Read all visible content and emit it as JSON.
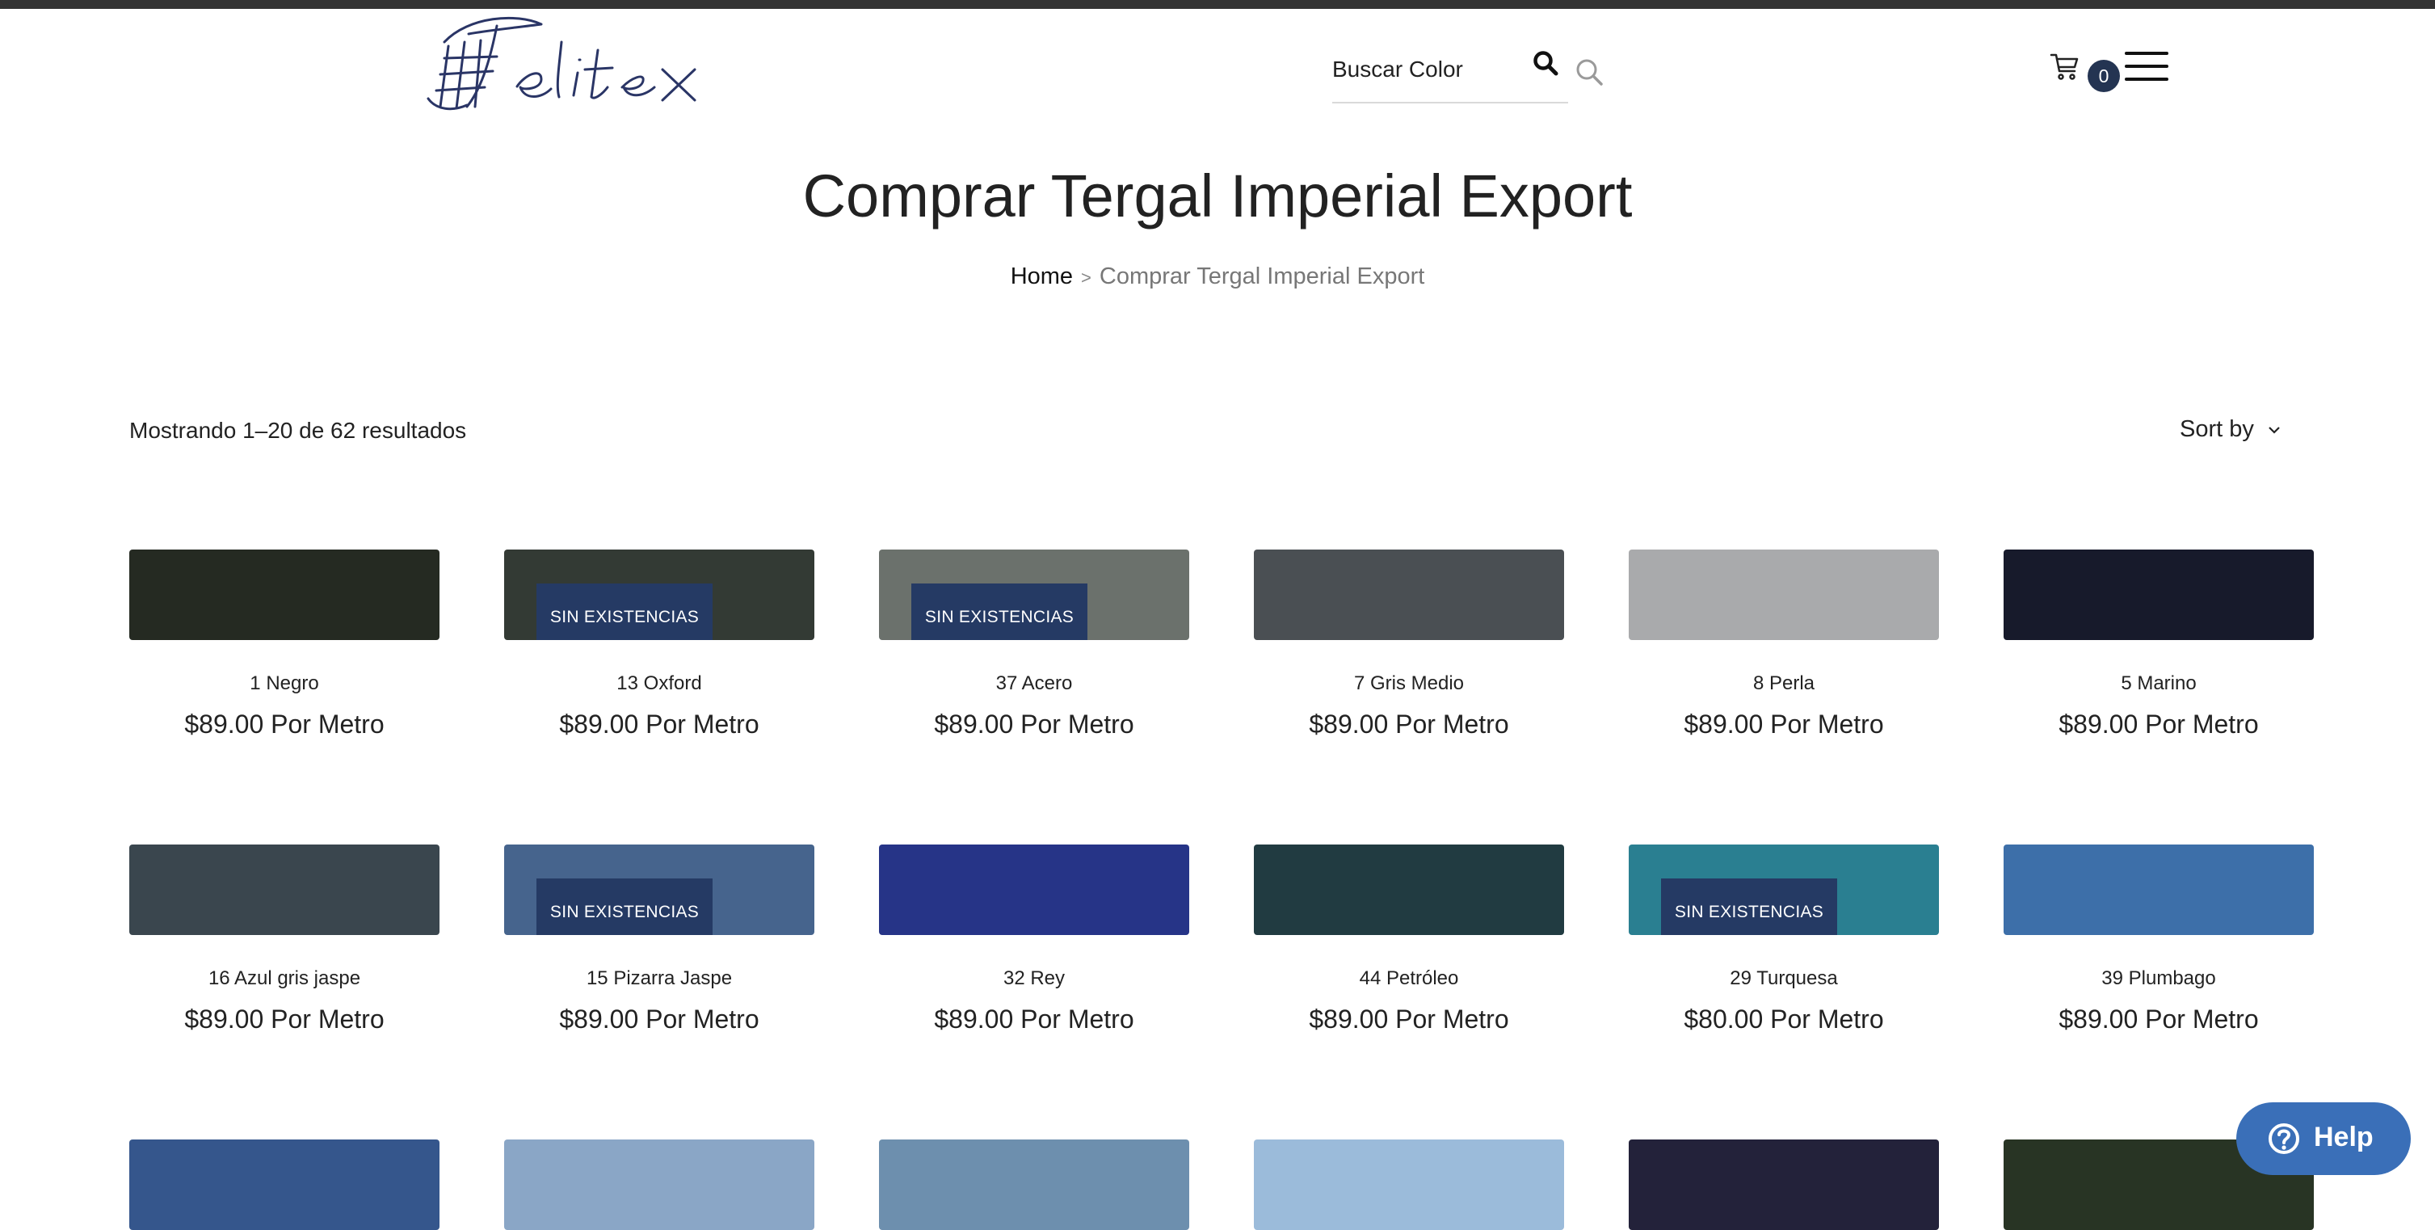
{
  "header": {
    "search_placeholder": "Buscar Color",
    "cart_count": "0"
  },
  "page": {
    "title": "Comprar Tergal Imperial Export",
    "breadcrumb": {
      "home": "Home",
      "separator": ">",
      "current": "Comprar Tergal Imperial Export"
    },
    "results_text": "Mostrando 1–20 de 62 resultados",
    "sort_label": "Sort by"
  },
  "products": [
    {
      "name": "1 Negro",
      "price": "$89.00 Por Metro",
      "color": "#252a22",
      "badge": ""
    },
    {
      "name": "13 Oxford",
      "price": "$89.00 Por Metro",
      "color": "#333a34",
      "badge": "SIN EXISTENCIAS"
    },
    {
      "name": "37 Acero",
      "price": "$89.00 Por Metro",
      "color": "#6b716c",
      "badge": "SIN EXISTENCIAS"
    },
    {
      "name": "7 Gris Medio",
      "price": "$89.00 Por Metro",
      "color": "#4a4f53",
      "badge": ""
    },
    {
      "name": "8 Perla",
      "price": "$89.00 Por Metro",
      "color": "#a9aaac",
      "badge": ""
    },
    {
      "name": "5 Marino",
      "price": "$89.00 Por Metro",
      "color": "#171a2b",
      "badge": ""
    },
    {
      "name": "16 Azul gris jaspe",
      "price": "$89.00 Por Metro",
      "color": "#3a464e",
      "badge": ""
    },
    {
      "name": "15 Pizarra Jaspe",
      "price": "$89.00 Por Metro",
      "color": "#46648d",
      "badge": "SIN EXISTENCIAS"
    },
    {
      "name": "32 Rey",
      "price": "$89.00 Por Metro",
      "color": "#263487",
      "badge": ""
    },
    {
      "name": "44 Petróleo",
      "price": "$89.00 Por Metro",
      "color": "#213b41",
      "badge": ""
    },
    {
      "name": "29 Turquesa",
      "price": "$80.00 Por Metro",
      "color": "#2a7f91",
      "badge": "SIN EXISTENCIAS"
    },
    {
      "name": "39 Plumbago",
      "price": "$89.00 Por Metro",
      "color": "#3d6fa9",
      "badge": ""
    },
    {
      "name": "",
      "price": "",
      "color": "#35568c",
      "badge": ""
    },
    {
      "name": "",
      "price": "",
      "color": "#8aa6c6",
      "badge": ""
    },
    {
      "name": "",
      "price": "",
      "color": "#6d8fae",
      "badge": ""
    },
    {
      "name": "",
      "price": "",
      "color": "#9bbbda",
      "badge": ""
    },
    {
      "name": "",
      "price": "",
      "color": "#23223a",
      "badge": ""
    },
    {
      "name": "",
      "price": "",
      "color": "#283424",
      "badge": ""
    }
  ],
  "help": {
    "label": "Help"
  }
}
